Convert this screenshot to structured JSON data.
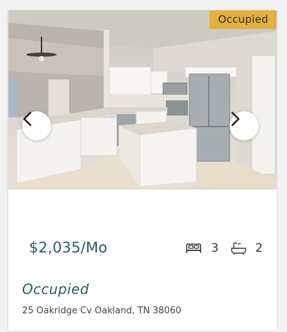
{
  "listing": {
    "badge": "Occupied",
    "price": "$2,035/Mo",
    "beds": "3",
    "baths": "2",
    "status": "Occupied",
    "address": "25 Oakridge Cv Oakland, TN 38060"
  },
  "icons": {
    "prev": "chevron-left-icon",
    "next": "chevron-right-icon",
    "beds": "bed-icon",
    "baths": "bathtub-icon"
  },
  "colors": {
    "badge_bg": "#e4b13e",
    "accent": "#2d5a63"
  }
}
